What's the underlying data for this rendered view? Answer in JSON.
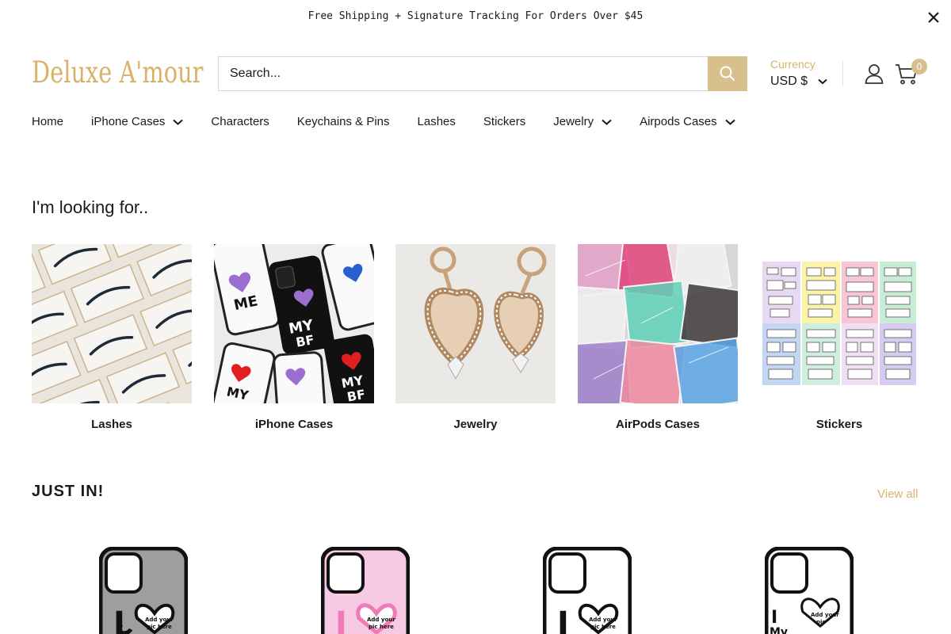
{
  "announcement": {
    "text": "Free Shipping + Signature Tracking For Orders Over $45"
  },
  "header": {
    "logo": "Deluxe A'mour",
    "search_placeholder": "Search...",
    "currency_label": "Currency",
    "currency_value": "USD $",
    "cart_count": "0"
  },
  "nav": {
    "items": [
      {
        "label": "Home"
      },
      {
        "label": "iPhone Cases"
      },
      {
        "label": "Characters"
      },
      {
        "label": "Keychains & Pins"
      },
      {
        "label": "Lashes"
      },
      {
        "label": "Stickers"
      },
      {
        "label": "Jewelry"
      },
      {
        "label": "Airpods Cases"
      }
    ]
  },
  "looking_for": {
    "title": "I'm looking for..",
    "categories": [
      {
        "label": "Lashes"
      },
      {
        "label": "iPhone Cases"
      },
      {
        "label": "Jewelry"
      },
      {
        "label": "AirPods Cases"
      },
      {
        "label": "Stickers"
      }
    ]
  },
  "just_in": {
    "title": "JUST IN!",
    "view_all": "View all",
    "products": [
      {
        "case_color": "#9e9e9e",
        "caption": "Add your pic here"
      },
      {
        "case_color": "#f7c9e3",
        "caption": "Add your pic here"
      },
      {
        "case_color": "#ffffff",
        "caption": "Add your pic here"
      },
      {
        "case_color": "#ffffff",
        "caption": "Add your pic"
      }
    ]
  },
  "colors": {
    "accent": "#d9b26a",
    "button": "#d8c08e"
  }
}
